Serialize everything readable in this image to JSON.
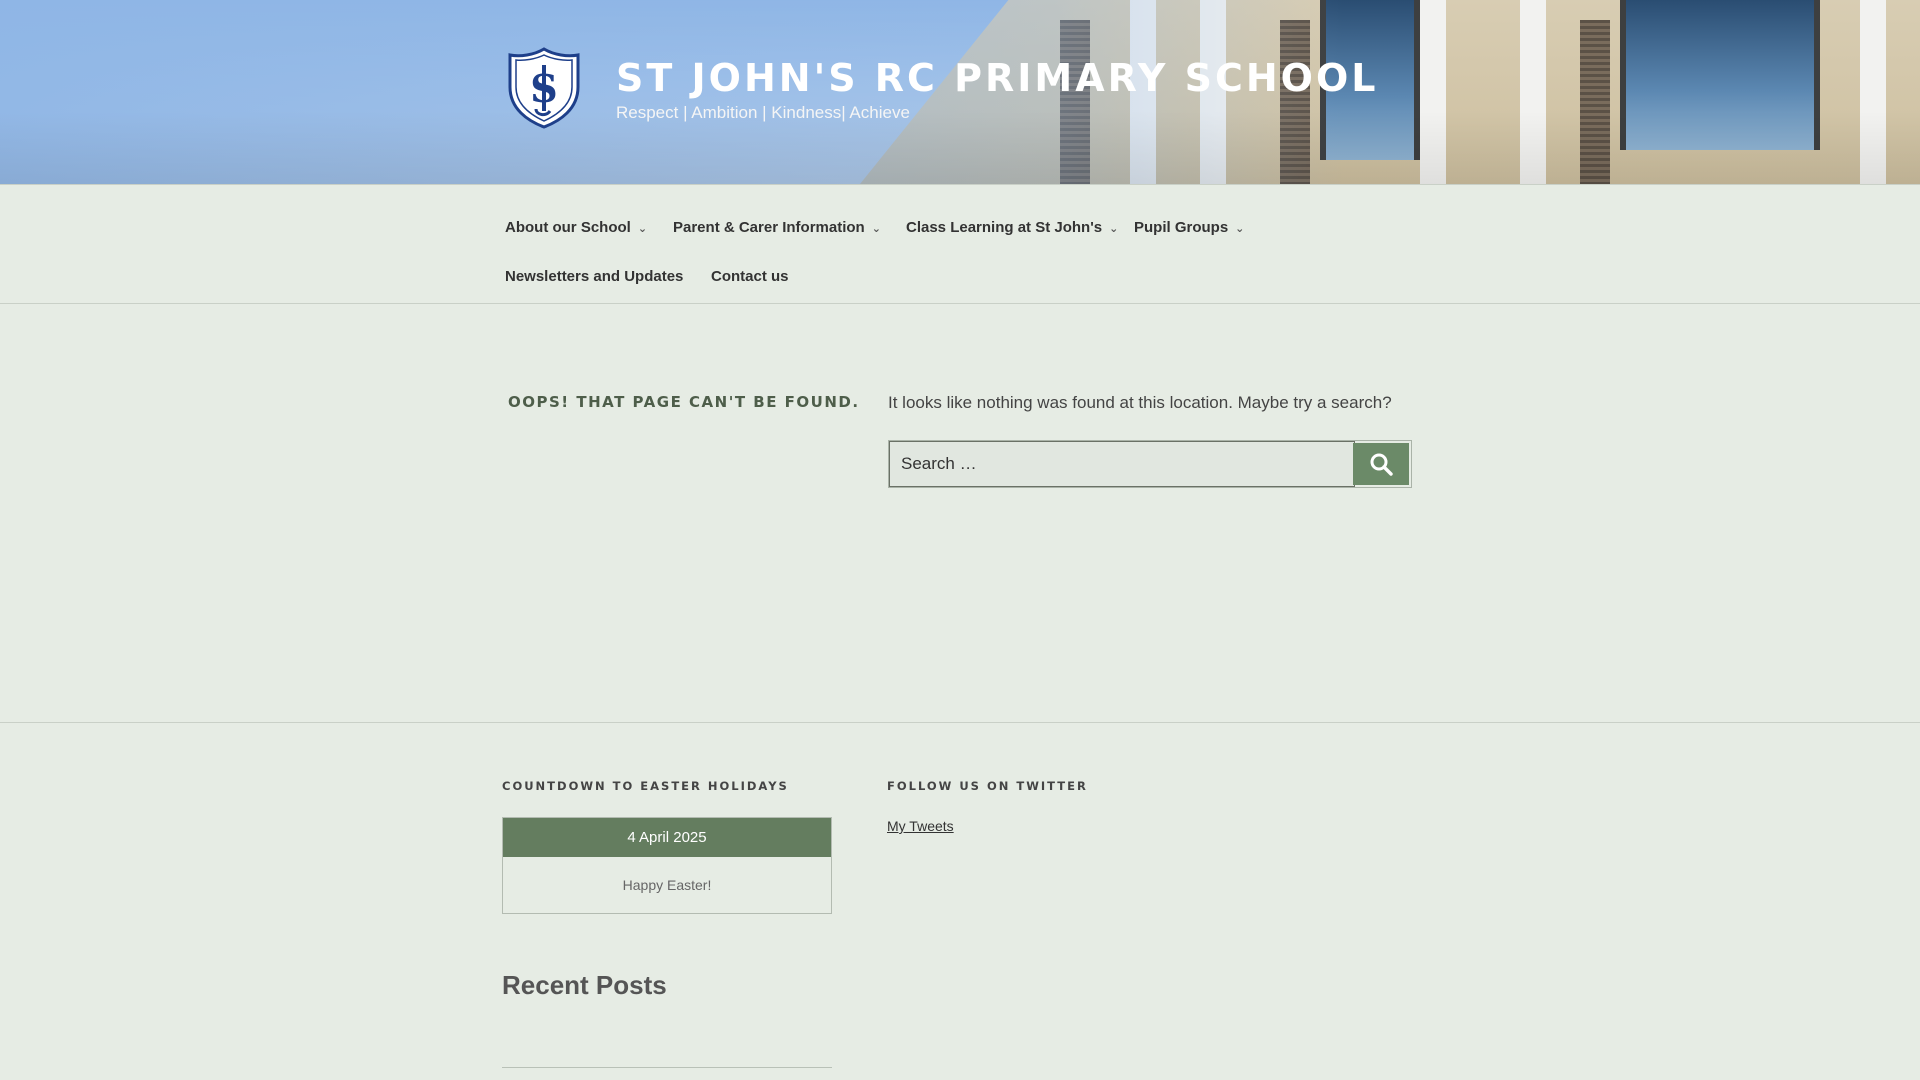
{
  "header": {
    "title": "ST JOHN'S RC PRIMARY SCHOOL",
    "tagline": "Respect | Ambition | Kindness| Achieve",
    "logo_icon": "school-crest-icon"
  },
  "nav": {
    "items": [
      {
        "label": "About our School",
        "has_submenu": true
      },
      {
        "label": "Parent & Carer Information",
        "has_submenu": true
      },
      {
        "label": "Class Learning at St John's",
        "has_submenu": true
      },
      {
        "label": "Pupil Groups",
        "has_submenu": true
      },
      {
        "label": "Newsletters and Updates",
        "has_submenu": false
      },
      {
        "label": "Contact us",
        "has_submenu": false
      }
    ]
  },
  "main": {
    "error_title": "OOPS! THAT PAGE CAN'T BE FOUND.",
    "error_text": "It looks like nothing was found at this location. Maybe try a search?",
    "search": {
      "placeholder": "Search …",
      "button_icon": "search-icon"
    }
  },
  "footer": {
    "countdown": {
      "title": "COUNTDOWN TO EASTER HOLIDAYS",
      "date": "4 April 2025",
      "message": "Happy Easter!"
    },
    "twitter": {
      "title": "FOLLOW US ON TWITTER",
      "link": "My Tweets"
    },
    "recent_posts": {
      "title": "Recent Posts"
    }
  },
  "colors": {
    "background": "#e6ece4",
    "accent": "#647d5f",
    "search_button": "#6b8a68",
    "text": "#333333"
  }
}
